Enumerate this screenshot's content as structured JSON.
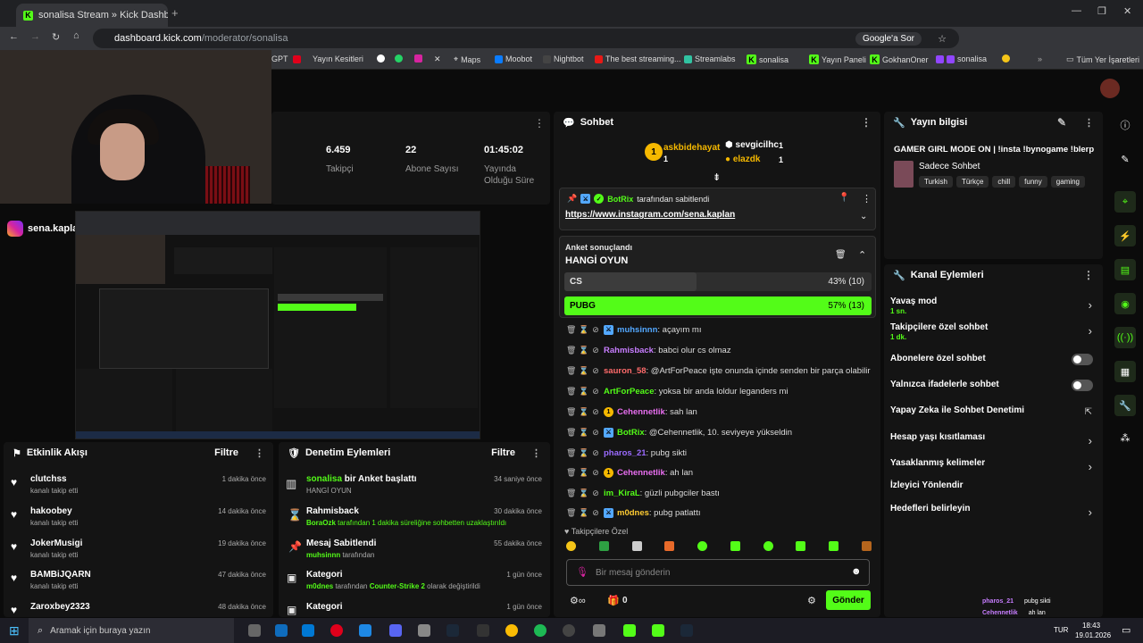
{
  "browser": {
    "tab_title": "sonalisa Stream » Kick Dashbo",
    "url_host": "dashboard.kick.com",
    "url_path": "/moderator/sonalisa",
    "google_btn": "Google'a Sor",
    "bookmarks": [
      "GPT",
      "Yayın Kesitleri",
      "Maps",
      "Moobot",
      "Nightbot",
      "The best streaming...",
      "Streamlabs",
      "sonalisa",
      "Yayın Paneli",
      "GokhanOner",
      "sonalisa",
      "Tüm Yer İşaretleri"
    ]
  },
  "stats": [
    {
      "value": "6.459",
      "label": "Takipçi"
    },
    {
      "value": "22",
      "label": "Abone Sayısı"
    },
    {
      "value": "01:45:02",
      "label": "Yayında Olduğu Süre"
    }
  ],
  "cam_overlay": {
    "handle": "sena.kaplan"
  },
  "chat": {
    "title": "Sohbet",
    "top_gifters": [
      {
        "name": "askbidehayat",
        "rank": "1",
        "count": "1"
      },
      {
        "name": "sevgicilhc",
        "count": "1"
      },
      {
        "name": "elazdk",
        "count": "1"
      }
    ],
    "pinned": {
      "by": "BotRix",
      "by_suffix": "tarafından sabitlendi",
      "link": "https://www.instagram.com/sena.kaplan"
    },
    "poll": {
      "heading": "Anket sonuçlandı",
      "question": "HANGİ OYUN",
      "options": [
        {
          "label": "CS",
          "result": "43% (10)",
          "pct": 43
        },
        {
          "label": "PUBG",
          "result": "57% (13)",
          "pct": 57
        }
      ]
    },
    "messages": [
      {
        "user": "muhsinnn",
        "text": ": açayım mı",
        "color": "#53a8ff"
      },
      {
        "user": "Rahmisback",
        "text": ": babci olur cs olmaz",
        "color": "#c77dff"
      },
      {
        "user": "sauron_58",
        "text": ": @ArtForPeace işte onunda içinde senden bir parça olabilir",
        "color": "#ff6b6b"
      },
      {
        "user": "ArtForPeace",
        "text": ": yoksa bir anda loldur leganders mi",
        "color": "#53fc18"
      },
      {
        "user": "Cehennetlik",
        "text": ": sah lan",
        "color": "#e86ef0"
      },
      {
        "user": "BotRix",
        "text": ": @Cehennetlik, 10. seviyeye yükseldin",
        "color": "#53fc18"
      },
      {
        "user": "pharos_21",
        "text": ": pubg sikti",
        "color": "#9b6bff"
      },
      {
        "user": "Cehennetlik",
        "text": ": ah lan",
        "color": "#e86ef0"
      },
      {
        "user": "im_KiraL",
        "text": ": güzli pubgciler bastı",
        "color": "#53fc18"
      },
      {
        "user": "m0dnes",
        "text": ": pubg patlattı",
        "color": "#ffcc33"
      }
    ],
    "followers_only": "Takipçilere Özel",
    "input_placeholder": "Bir mesaj gönderin",
    "points": "0",
    "send": "Gönder"
  },
  "stream_info": {
    "title": "Yayın bilgisi",
    "stream_title": "GAMER GIRL MODE ON | !insta !bynogame !blerp",
    "category": "Sadece Sohbet",
    "tags": [
      "Turkish",
      "Türkçe",
      "chill",
      "funny",
      "gaming"
    ]
  },
  "channel_actions": {
    "title": "Kanal Eylemleri",
    "items": [
      {
        "label": "Yavaş mod",
        "sub": "1 sn."
      },
      {
        "label": "Takipçilere özel sohbet",
        "sub": "1 dk."
      },
      {
        "label": "Abonelere özel sohbet"
      },
      {
        "label": "Yalnızca ifadelerle sohbet"
      },
      {
        "label": "Yapay Zeka ile Sohbet Denetimi"
      },
      {
        "label": "Hesap yaşı kısıtlaması"
      },
      {
        "label": "Yasaklanmış kelimeler"
      },
      {
        "label": "İzleyici Yönlendir"
      },
      {
        "label": "Hedefleri belirleyin"
      }
    ]
  },
  "activity": {
    "title": "Etkinlik Akışı",
    "filter": "Filtre",
    "items": [
      {
        "name": "clutchss",
        "sub": "kanalı takip etti",
        "time": "1 dakika önce"
      },
      {
        "name": "hakoobey",
        "sub": "kanalı takip etti",
        "time": "14 dakika önce"
      },
      {
        "name": "JokerMusigi",
        "sub": "kanalı takip etti",
        "time": "19 dakika önce"
      },
      {
        "name": "BAMBiJQARN",
        "sub": "kanalı takip etti",
        "time": "47 dakika önce"
      },
      {
        "name": "Zaroxbey2323",
        "sub": "",
        "time": "48 dakika önce"
      }
    ]
  },
  "moderation": {
    "title": "Denetim Eylemleri",
    "filter": "Filtre",
    "items": [
      {
        "name": "sonalisa",
        "name_rest": " bir Anket başlattı",
        "sub": "HANGİ OYUN",
        "time": "34 saniye önce"
      },
      {
        "name": "Rahmisback",
        "name_rest": "",
        "sub_user": "BoraOzk",
        "sub": " tarafından 1 dakika süreliğine sohbetten uzaklaştırıldı",
        "time": "30 dakika önce"
      },
      {
        "name": "Mesaj Sabitlendi",
        "name_rest": "",
        "sub_user": "muhsinnn",
        "sub": " tarafından",
        "time": "55 dakika önce"
      },
      {
        "name": "Kategori",
        "name_rest": "",
        "sub_user": "m0dnes",
        "sub": " tarafından ",
        "sub_hl": "Counter-Strike 2",
        "sub_end": " olarak değiştirildi",
        "time": "1 gün önce"
      },
      {
        "name": "Kategori",
        "name_rest": "",
        "time": "1 gün önce"
      }
    ]
  },
  "overlay_chat": [
    {
      "user": "pharos_21",
      "text": "pubg sikti"
    },
    {
      "user": "Cehennetlik",
      "text": "ah lan"
    },
    {
      "user": "im_KiraL",
      "text": "güzli pubgciler bastı"
    },
    {
      "user": "m0dnes",
      "text": "pubg patlattı"
    }
  ],
  "taskbar": {
    "search": "Aramak için buraya yazın",
    "lang": "TUR",
    "time": "18:43",
    "date": "19.01.2026"
  },
  "colors": {
    "accent": "#53fc18",
    "panel": "#141414",
    "bg": "#0b0b0b"
  }
}
